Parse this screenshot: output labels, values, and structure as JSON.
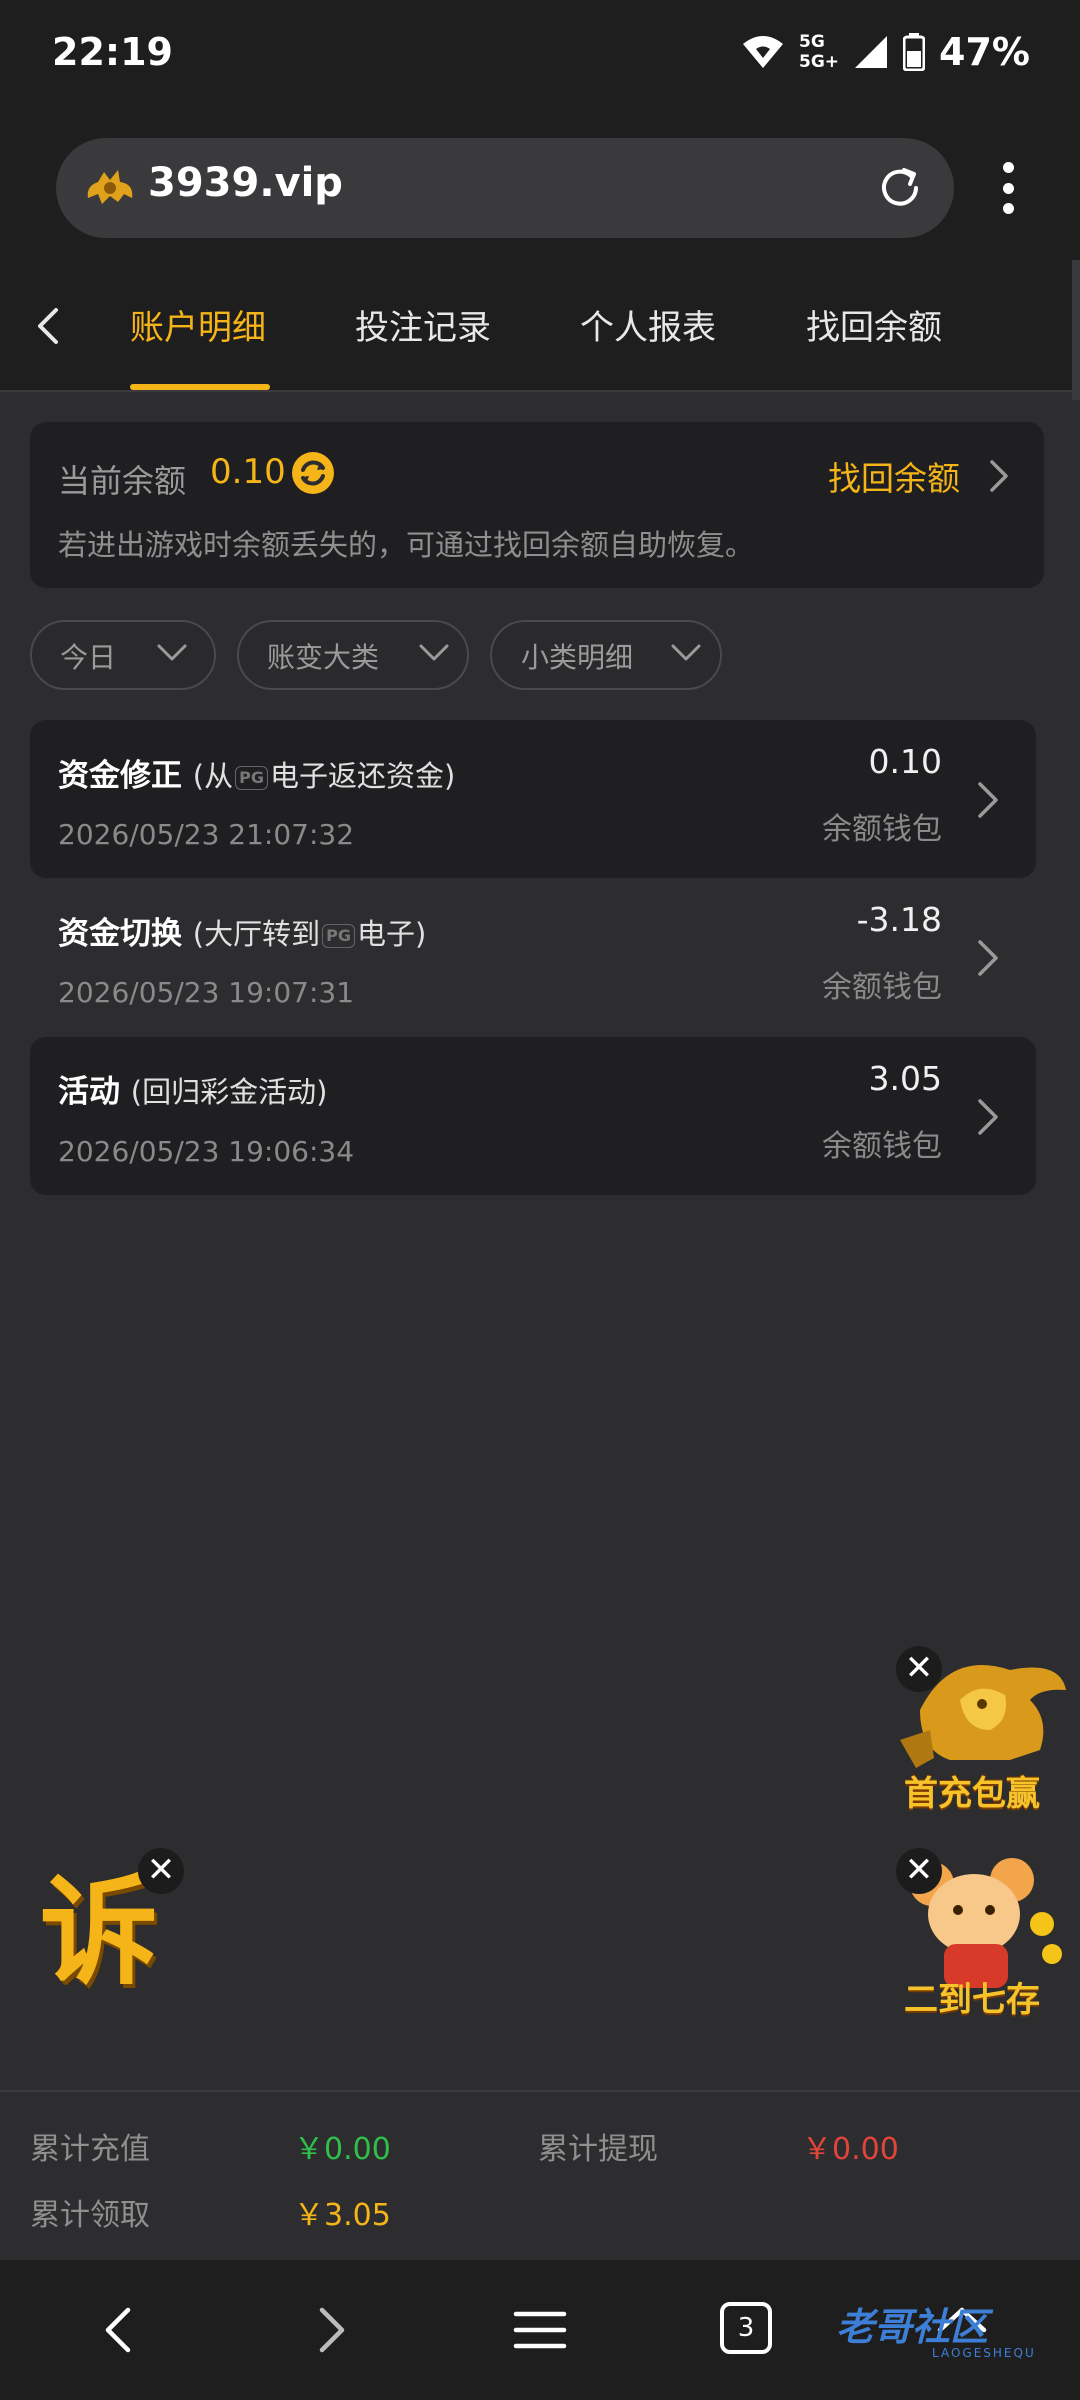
{
  "status_bar": {
    "time": "22:19",
    "net_top": "5G",
    "net_bottom": "5G+",
    "battery": "47%"
  },
  "browser": {
    "url": "3939.vip",
    "reload_icon": "reload-icon",
    "menu_icon": "kebab-menu-icon"
  },
  "tabs": [
    {
      "label": "账户明细",
      "active": true
    },
    {
      "label": "投注记录",
      "active": false
    },
    {
      "label": "个人报表",
      "active": false
    },
    {
      "label": "找回余额",
      "active": false
    }
  ],
  "balance": {
    "label": "当前余额",
    "value": "0.10",
    "recover_label": "找回余额",
    "note": "若进出游戏时余额丢失的，可通过找回余额自助恢复。"
  },
  "filters": [
    {
      "label": "今日"
    },
    {
      "label": "账变大类"
    },
    {
      "label": "小类明细"
    }
  ],
  "records": [
    {
      "title": "资金修正",
      "sub_before": "(从",
      "sub_badge": "PG",
      "sub_after": "电子返还资金)",
      "date": "2026/05/23 21:07:32",
      "amount": "0.10",
      "wallet": "余额钱包"
    },
    {
      "title": "资金切换",
      "sub_before": "(大厅转到",
      "sub_badge": "PG",
      "sub_after": "电子)",
      "date": "2026/05/23 19:07:31",
      "amount": "-3.18",
      "wallet": "余额钱包"
    },
    {
      "title": "活动",
      "sub_before": "(回归彩金活动)",
      "sub_badge": "",
      "sub_after": "",
      "date": "2026/05/23 19:06:34",
      "amount": "3.05",
      "wallet": "余额钱包"
    }
  ],
  "promos": {
    "lion_label": "首充包赢",
    "rat_label": "二到七存",
    "left_glyph": "诉",
    "close_symbol": "✕"
  },
  "summary": {
    "recharge_label": "累计充值",
    "recharge_value": "￥0.00",
    "withdraw_label": "累计提现",
    "withdraw_value": "￥0.00",
    "claim_label": "累计领取",
    "claim_value": "￥3.05"
  },
  "bottom_nav": {
    "tab_count": "3",
    "watermark": "老哥社区",
    "watermark_sub": "LAOGESHEQU"
  },
  "colors": {
    "accent": "#f5b418",
    "positive": "#2fbf4a",
    "negative": "#e0443a",
    "watermark": "#3d7fd6"
  }
}
